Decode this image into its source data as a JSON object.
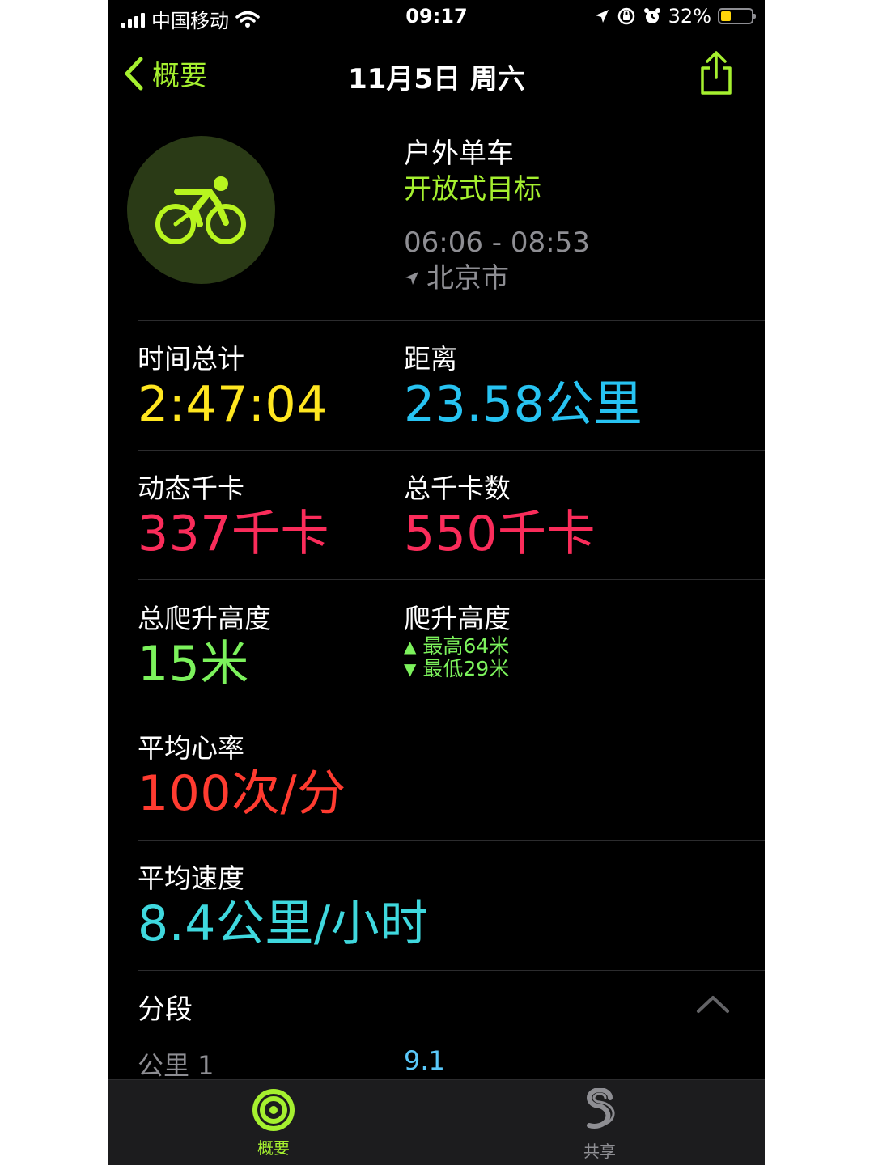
{
  "status_bar": {
    "carrier": "中国移动",
    "time": "09:17",
    "battery": "32%",
    "battery_level": 0.32
  },
  "nav": {
    "back_label": "概要",
    "title": "11月5日 周六"
  },
  "workout": {
    "type": "户外单车",
    "goal": "开放式目标",
    "time_range": "06:06 - 08:53",
    "location": "北京市"
  },
  "metrics": {
    "total_time": {
      "label": "时间总计",
      "value": "2:47:04"
    },
    "distance": {
      "label": "距离",
      "value": "23.58公里"
    },
    "active_kcal": {
      "label": "动态千卡",
      "value": "337千卡"
    },
    "total_kcal": {
      "label": "总千卡数",
      "value": "550千卡"
    },
    "total_climb": {
      "label": "总爬升高度",
      "value": "15米"
    },
    "elevation": {
      "label": "爬升高度",
      "high": "最高64米",
      "low": "最低29米"
    },
    "avg_hr": {
      "label": "平均心率",
      "value": "100次/分"
    },
    "avg_speed": {
      "label": "平均速度",
      "value": "8.4公里/小时"
    }
  },
  "splits": {
    "title": "分段",
    "rows": [
      {
        "label": "公里 1",
        "value": "9.1"
      }
    ]
  },
  "tabs": [
    {
      "label": "概要",
      "icon": "activity-rings-icon",
      "active": true
    },
    {
      "label": "共享",
      "icon": "sharing-icon",
      "active": false
    }
  ],
  "colors": {
    "accent": "#a5f02f",
    "time": "#ffe620",
    "distance": "#27c3f2",
    "kcal": "#fa2c5a",
    "climb": "#7cf25c",
    "heart_rate": "#ff3b30",
    "speed": "#3fd8de"
  }
}
